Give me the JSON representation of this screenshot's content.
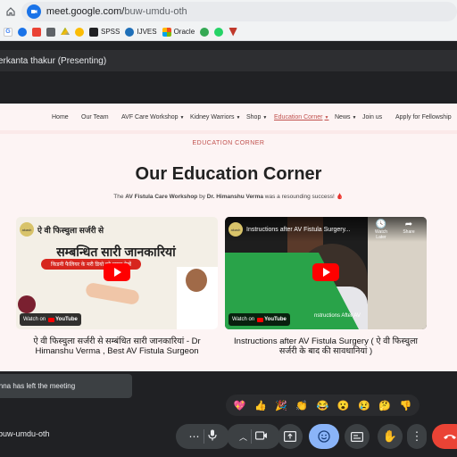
{
  "browser": {
    "url_host": "meet.google.com/",
    "url_path": "buw-umdu-oth",
    "bookmarks": [
      {
        "label": "",
        "color": "#4285f4"
      },
      {
        "label": "",
        "color": "#1a73e8"
      },
      {
        "label": "",
        "color": "#ea4335"
      },
      {
        "label": "",
        "color": "#5f6368"
      },
      {
        "label": "",
        "color": "#34a853"
      },
      {
        "label": "",
        "color": "#fbbc04"
      },
      {
        "label": "SPSS",
        "color": "#202124"
      },
      {
        "label": "IJVES",
        "color": "#1e6fb8"
      },
      {
        "label": "Oracle",
        "color": "#f25022"
      },
      {
        "label": "",
        "color": "#34a853"
      },
      {
        "label": "",
        "color": "#25d366"
      },
      {
        "label": "",
        "color": "#c0392b"
      }
    ]
  },
  "meet": {
    "presenting_label": "erkanta thakur (Presenting)",
    "toast": "inna has left the meeting",
    "meeting_code": "buw-umdu-oth",
    "reactions": [
      "💖",
      "👍",
      "🎉",
      "👏",
      "😂",
      "😮",
      "😢",
      "🤔",
      "👎"
    ]
  },
  "site": {
    "nav": [
      "Home",
      "Our Team",
      "AVF Care Workshop",
      "Kidney Warriors",
      "Shop",
      "Education Corner",
      "News",
      "Join us",
      "Apply for Fellowship"
    ],
    "section_label": "EDUCATION CORNER",
    "title": "Our Education Corner",
    "sub_pre": "The ",
    "sub_workshop": "AV Fistula Care Workshop",
    "sub_mid": " by ",
    "sub_doctor": "Dr. Himanshu Verma",
    "sub_post": " was a resounding success! ",
    "sub_icon": "🩸"
  },
  "videos": [
    {
      "title": "ऐ वी फिस्चुला सर्जरी से",
      "line2": "सम्बन्धित सारी जानकारियां",
      "banner": "किडनी फैलियर के मरी   डियो को जरूर देखें",
      "watch_on": "Watch on",
      "youtube": "YouTube",
      "caption": "ऐ वी फिस्चुला सर्जरी से सम्बंधित सारी जानकारियां - Dr Himanshu Verma , Best AV Fistula Surgeon"
    },
    {
      "title": "Instructions after AV Fistula Surgery...",
      "watch_later": "Watch Later",
      "share": "Share",
      "overlay": "nstructions After AV",
      "watch_on": "Watch on",
      "youtube": "YouTube",
      "caption": "Instructions after AV Fistula Surgery ( ऐ वी फिस्चुला सर्जरी के बाद की सावधानियां )"
    }
  ],
  "channel_avatar": "akash"
}
